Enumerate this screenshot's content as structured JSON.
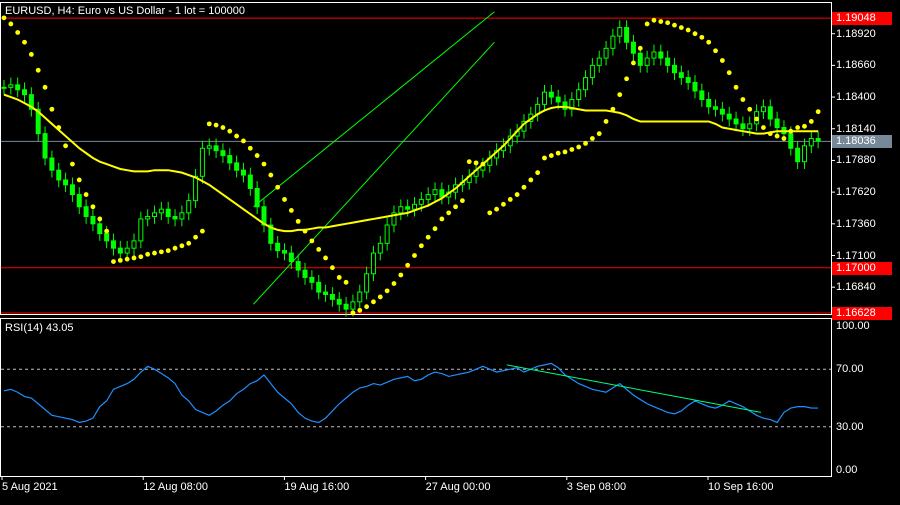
{
  "header": {
    "symbol_info": "EURUSD, H4:  Euro vs US Dollar - 1 lot = 100000",
    "rsi_label": "RSI(14) 43.05"
  },
  "price_axis": {
    "ticks": [
      "1.18920",
      "1.18660",
      "1.18400",
      "1.18140",
      "1.17880",
      "1.17620",
      "1.17360",
      "1.17100",
      "1.16840"
    ],
    "tick_values": [
      1.1892,
      1.1866,
      1.184,
      1.1814,
      1.1788,
      1.1762,
      1.1736,
      1.171,
      1.1684
    ]
  },
  "rsi_axis": {
    "ticks": [
      "100.00",
      "70.00",
      "30.00",
      "0.00"
    ],
    "tick_values": [
      100,
      70,
      30,
      0
    ]
  },
  "levels": [
    {
      "name": "resistance-high",
      "value": 1.19048,
      "label": "1.19048",
      "color": "#ff0000",
      "tag_bg": "#ff0000"
    },
    {
      "name": "current-price",
      "value": 1.18036,
      "label": "1.18036",
      "color": "#778899",
      "tag_bg": "#778899"
    },
    {
      "name": "support-mid",
      "value": 1.17,
      "label": "1.17000",
      "color": "#ff0000",
      "tag_bg": "#ff0000"
    },
    {
      "name": "support-low",
      "value": 1.16628,
      "label": "1.16628",
      "color": "#ff0000",
      "tag_bg": "#ff0000"
    }
  ],
  "time_axis": {
    "labels": [
      "5 Aug 2021",
      "12 Aug 08:00",
      "19 Aug 16:00",
      "27 Aug 00:00",
      "3 Sep 08:00",
      "10 Sep 16:00"
    ]
  },
  "colors": {
    "candle": "#00ff00",
    "ma": "#ffff00",
    "sar": "#ffff00",
    "rsi": "#1e90ff",
    "trendline": "#00ff7f",
    "channel": "#00ff00",
    "grid_dash": "#c0c0c0"
  },
  "chart_data": [
    {
      "type": "line",
      "name": "price",
      "title": "EURUSD, H4:  Euro vs US Dollar - 1 lot = 100000",
      "ylim": [
        1.1662,
        1.1918
      ],
      "close": [
        1.1848,
        1.185,
        1.1846,
        1.1842,
        1.183,
        1.181,
        1.179,
        1.178,
        1.1772,
        1.1768,
        1.176,
        1.175,
        1.1742,
        1.1736,
        1.1728,
        1.1722,
        1.1716,
        1.1712,
        1.1716,
        1.1722,
        1.174,
        1.1742,
        1.1745,
        1.1748,
        1.1742,
        1.174,
        1.1745,
        1.1755,
        1.1775,
        1.1798,
        1.18,
        1.1796,
        1.1792,
        1.1786,
        1.178,
        1.1776,
        1.1765,
        1.175,
        1.1735,
        1.172,
        1.1714,
        1.1712,
        1.1705,
        1.1698,
        1.1692,
        1.1688,
        1.168,
        1.1678,
        1.1674,
        1.167,
        1.1666,
        1.1672,
        1.168,
        1.1695,
        1.1712,
        1.172,
        1.1735,
        1.1745,
        1.175,
        1.1748,
        1.1752,
        1.1756,
        1.176,
        1.1764,
        1.1758,
        1.1762,
        1.1768,
        1.177,
        1.1775,
        1.178,
        1.1784,
        1.179,
        1.1796,
        1.18,
        1.1808,
        1.1812,
        1.182,
        1.1826,
        1.1834,
        1.1844,
        1.184,
        1.1836,
        1.183,
        1.1838,
        1.1846,
        1.1856,
        1.1866,
        1.1872,
        1.188,
        1.189,
        1.1897,
        1.1885,
        1.1876,
        1.1866,
        1.1872,
        1.1877,
        1.1872,
        1.1866,
        1.186,
        1.1856,
        1.1852,
        1.1845,
        1.1838,
        1.1832,
        1.183,
        1.1826,
        1.1822,
        1.1818,
        1.1814,
        1.1818,
        1.1828,
        1.1832,
        1.1822,
        1.1815,
        1.181,
        1.1798,
        1.1787,
        1.18,
        1.1806,
        1.1804
      ],
      "sar": [
        1.1905,
        1.19,
        1.1893,
        1.1885,
        1.1875,
        1.1862,
        1.1848,
        1.183,
        1.1815,
        1.18,
        1.1785,
        1.1772,
        1.176,
        1.175,
        1.174,
        1.173,
        1.1705,
        1.1706,
        1.1707,
        1.1708,
        1.1709,
        1.1711,
        1.1712,
        1.1713,
        1.1714,
        1.1716,
        1.1718,
        1.172,
        1.1725,
        1.173,
        1.1818,
        1.1817,
        1.1815,
        1.1812,
        1.1808,
        1.1804,
        1.1798,
        1.1792,
        1.1785,
        1.1776,
        1.1766,
        1.1756,
        1.1747,
        1.1738,
        1.173,
        1.1722,
        1.1715,
        1.1708,
        1.17,
        1.1692,
        1.1688,
        1.1663,
        1.1665,
        1.1668,
        1.1672,
        1.1676,
        1.1681,
        1.1687,
        1.1694,
        1.1702,
        1.171,
        1.1718,
        1.1725,
        1.1732,
        1.174,
        1.1745,
        1.175,
        1.1755,
        1.1787,
        1.1786,
        1.1785,
        1.1745,
        1.1748,
        1.1752,
        1.1756,
        1.176,
        1.1766,
        1.1772,
        1.1778,
        1.179,
        1.1792,
        1.1794,
        1.1795,
        1.1797,
        1.1799,
        1.1802,
        1.1806,
        1.181,
        1.182,
        1.183,
        1.1842,
        1.1855,
        1.1868,
        1.188,
        1.19,
        1.1903,
        1.1902,
        1.1901,
        1.1899,
        1.1897,
        1.1895,
        1.1892,
        1.1889,
        1.1885,
        1.1878,
        1.187,
        1.186,
        1.1848,
        1.1838,
        1.183,
        1.1822,
        1.1815,
        1.181,
        1.1808,
        1.1806,
        1.1812,
        1.1815,
        1.1816,
        1.182,
        1.1828
      ],
      "ma": [
        1.1842,
        1.184,
        1.1838,
        1.1835,
        1.1832,
        1.1828,
        1.1823,
        1.1818,
        1.1813,
        1.1808,
        1.1803,
        1.1798,
        1.1794,
        1.179,
        1.1787,
        1.1785,
        1.1783,
        1.1781,
        1.178,
        1.1779,
        1.1779,
        1.1779,
        1.178,
        1.178,
        1.178,
        1.1779,
        1.1778,
        1.1776,
        1.1774,
        1.1771,
        1.1768,
        1.1764,
        1.176,
        1.1756,
        1.1752,
        1.1748,
        1.1744,
        1.174,
        1.1736,
        1.1733,
        1.1731,
        1.173,
        1.173,
        1.1731,
        1.1731,
        1.1732,
        1.1733,
        1.1733,
        1.1734,
        1.1735,
        1.1736,
        1.1737,
        1.1738,
        1.1739,
        1.174,
        1.1741,
        1.1742,
        1.1743,
        1.1744,
        1.1745,
        1.1747,
        1.1749,
        1.1751,
        1.1754,
        1.1757,
        1.1761,
        1.1765,
        1.177,
        1.1775,
        1.178,
        1.1785,
        1.179,
        1.1795,
        1.18,
        1.1806,
        1.1812,
        1.1818,
        1.1822,
        1.1826,
        1.1829,
        1.1831,
        1.1832,
        1.1832,
        1.1831,
        1.183,
        1.1829,
        1.1829,
        1.1829,
        1.1829,
        1.1828,
        1.1827,
        1.1825,
        1.1822,
        1.182,
        1.182,
        1.182,
        1.182,
        1.182,
        1.182,
        1.182,
        1.182,
        1.182,
        1.182,
        1.182,
        1.1818,
        1.1815,
        1.1814,
        1.1813,
        1.1812,
        1.1811,
        1.181,
        1.181,
        1.1811,
        1.1812,
        1.1812,
        1.1812,
        1.1812,
        1.1812,
        1.1812,
        1.1812
      ],
      "channel": {
        "lower": [
          [
            1.167,
            0.305
          ],
          [
            1.1885,
            0.595
          ]
        ],
        "upper": [
          [
            1.175,
            0.305
          ],
          [
            1.191,
            0.595
          ]
        ]
      }
    },
    {
      "type": "line",
      "name": "rsi",
      "title": "RSI(14) 43.05",
      "ylim": [
        0,
        100
      ],
      "values": [
        55,
        56,
        54,
        51,
        50,
        46,
        42,
        38,
        37,
        36,
        35,
        33,
        34,
        36,
        44,
        48,
        56,
        58,
        60,
        63,
        68,
        72,
        70,
        67,
        64,
        60,
        52,
        48,
        42,
        40,
        38,
        41,
        45,
        48,
        53,
        56,
        60,
        62,
        66,
        60,
        54,
        50,
        46,
        40,
        36,
        34,
        33,
        36,
        41,
        46,
        50,
        54,
        57,
        58,
        60,
        59,
        61,
        63,
        64,
        65,
        62,
        63,
        66,
        68,
        67,
        65,
        66,
        67,
        68,
        70,
        72,
        70,
        68,
        69,
        70,
        71,
        68,
        70,
        72,
        73,
        74,
        71,
        66,
        63,
        60,
        58,
        56,
        55,
        54,
        57,
        60,
        56,
        52,
        49,
        46,
        44,
        42,
        40,
        39,
        41,
        45,
        48,
        46,
        44,
        43,
        45,
        48,
        46,
        44,
        41,
        38,
        36,
        35,
        33,
        40,
        43,
        44,
        44,
        43,
        43
      ],
      "trendline": [
        [
          73,
          0.567
        ],
        [
          40,
          0.847
        ]
      ],
      "levels": [
        70,
        30
      ]
    }
  ]
}
